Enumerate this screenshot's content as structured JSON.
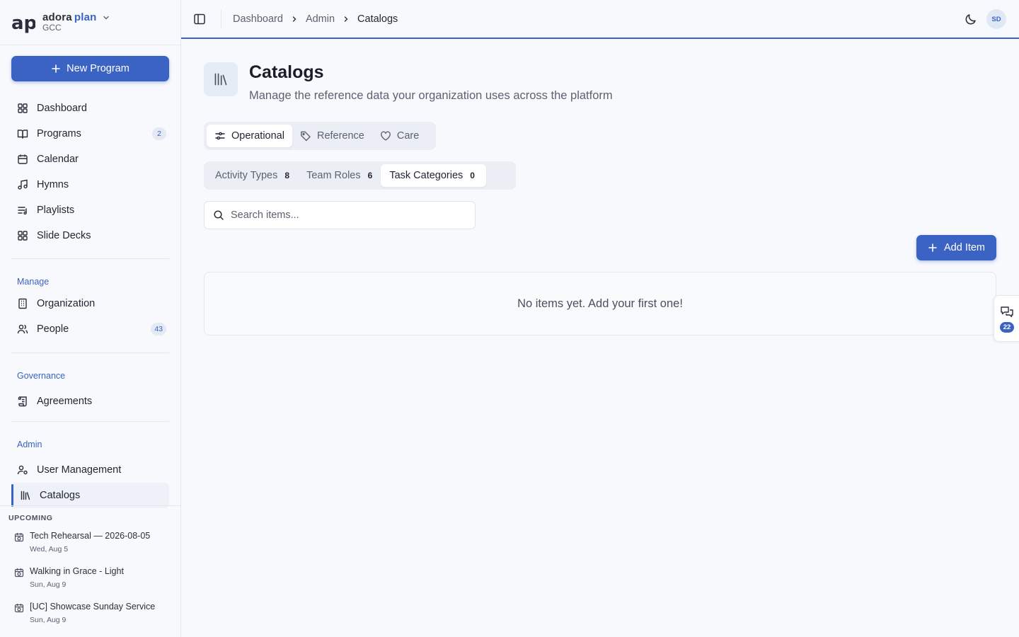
{
  "brand": {
    "name_primary": "adora",
    "name_accent": "plan",
    "org": "GCC",
    "logo_text": "ap"
  },
  "sidebar": {
    "new_program_label": "New Program",
    "main_items": [
      {
        "label": "Dashboard",
        "icon": "grid-icon"
      },
      {
        "label": "Programs",
        "icon": "book-open-icon",
        "badge": "2"
      },
      {
        "label": "Calendar",
        "icon": "calendar-icon"
      },
      {
        "label": "Hymns",
        "icon": "music-icon"
      },
      {
        "label": "Playlists",
        "icon": "playlist-icon"
      },
      {
        "label": "Slide Decks",
        "icon": "grid-icon"
      }
    ],
    "manage_label": "Manage",
    "manage_items": [
      {
        "label": "Organization",
        "icon": "building-icon"
      },
      {
        "label": "People",
        "icon": "users-icon",
        "badge": "43"
      }
    ],
    "governance_label": "Governance",
    "governance_items": [
      {
        "label": "Agreements",
        "icon": "scroll-icon"
      }
    ],
    "admin_label": "Admin",
    "admin_items": [
      {
        "label": "User Management",
        "icon": "user-cog-icon"
      },
      {
        "label": "Catalogs",
        "icon": "library-icon",
        "active": true
      }
    ],
    "upcoming_title": "UPCOMING",
    "upcoming": [
      {
        "title": "Tech Rehearsal — 2026-08-05",
        "date": "Wed, Aug 5"
      },
      {
        "title": "Walking in Grace - Light",
        "date": "Sun, Aug 9"
      },
      {
        "title": "[UC] Showcase Sunday Service",
        "date": "Sun, Aug 9"
      }
    ]
  },
  "header": {
    "breadcrumbs": [
      "Dashboard",
      "Admin",
      "Catalogs"
    ],
    "avatar_initials": "SD"
  },
  "page": {
    "title": "Catalogs",
    "subtitle": "Manage the reference data your organization uses across the platform",
    "category_tabs": [
      {
        "label": "Operational",
        "icon": "sliders-icon",
        "active": true
      },
      {
        "label": "Reference",
        "icon": "tag-icon"
      },
      {
        "label": "Care",
        "icon": "heart-icon"
      }
    ],
    "catalog_tabs": [
      {
        "label": "Activity Types",
        "count": "8"
      },
      {
        "label": "Team Roles",
        "count": "6"
      },
      {
        "label": "Task Categories",
        "count": "0",
        "active": true
      }
    ],
    "search_placeholder": "Search items...",
    "add_item_label": "Add Item",
    "empty_message": "No items yet. Add your first one!"
  },
  "chat": {
    "badge": "22"
  },
  "colors": {
    "accent": "#3a63c4",
    "background": "#f7f9fc",
    "text": "#1f2430",
    "muted": "#5b6272"
  }
}
